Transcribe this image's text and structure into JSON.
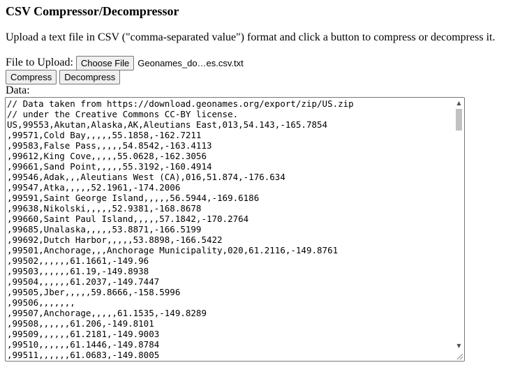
{
  "page": {
    "title": "CSV Compressor/Decompressor",
    "intro": "Upload a text file in CSV (\"comma-separated value\") format and click a button to compress or decompress it."
  },
  "upload": {
    "label": "File to Upload:",
    "choose_button": "Choose File",
    "file_name": "Geonames_do…es.csv.txt"
  },
  "actions": {
    "compress_label": "Compress",
    "decompress_label": "Decompress"
  },
  "data_section": {
    "label": "Data:",
    "lines": [
      "// Data taken from https://download.geonames.org/export/zip/US.zip",
      "// under the Creative Commons CC-BY license.",
      "US,99553,Akutan,Alaska,AK,Aleutians East,013,54.143,-165.7854",
      ",99571,Cold Bay,,,,,55.1858,-162.7211",
      ",99583,False Pass,,,,,54.8542,-163.4113",
      ",99612,King Cove,,,,,55.0628,-162.3056",
      ",99661,Sand Point,,,,,55.3192,-160.4914",
      ",99546,Adak,,,Aleutians West (CA),016,51.874,-176.634",
      ",99547,Atka,,,,,52.1961,-174.2006",
      ",99591,Saint George Island,,,,,56.5944,-169.6186",
      ",99638,Nikolski,,,,,52.9381,-168.8678",
      ",99660,Saint Paul Island,,,,,57.1842,-170.2764",
      ",99685,Unalaska,,,,,53.8871,-166.5199",
      ",99692,Dutch Harbor,,,,,53.8898,-166.5422",
      ",99501,Anchorage,,,Anchorage Municipality,020,61.2116,-149.8761",
      ",99502,,,,,,61.1661,-149.96",
      ",99503,,,,,,61.19,-149.8938",
      ",99504,,,,,,61.2037,-149.7447",
      ",99505,Jber,,,,,59.8666,-158.5996",
      ",99506,,,,,,,",
      ",99507,Anchorage,,,,,61.1535,-149.8289",
      ",99508,,,,,,61.206,-149.8101",
      ",99509,,,,,,61.2181,-149.9003",
      ",99510,,,,,,61.1446,-149.8784",
      ",99511,,,,,,61.0683,-149.8005"
    ]
  },
  "icons": {
    "scroll_up": "scroll-up-arrow",
    "scroll_down": "scroll-down-arrow",
    "resize": "resize-grip"
  }
}
